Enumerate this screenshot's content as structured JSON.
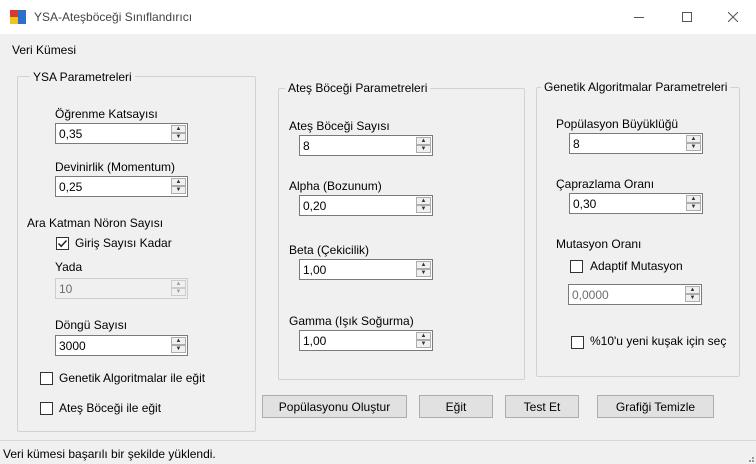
{
  "window": {
    "title": "YSA-Ateşböceği Sınıflandırıcı"
  },
  "menu": {
    "items": [
      "Veri Kümesi"
    ]
  },
  "ysa": {
    "title": "YSA Parametreleri",
    "learning_rate_label": "Öğrenme Katsayısı",
    "learning_rate": "0,35",
    "momentum_label": "Devinirlik (Momentum)",
    "momentum": "0,25",
    "hidden_label": "Ara Katman Nöron Sayısı",
    "input_count_label": "Giriş Sayısı Kadar",
    "input_count_checked": true,
    "or_label": "Yada",
    "hidden_count": "10",
    "epochs_label": "Döngü Sayısı",
    "epochs": "3000",
    "train_ga_label": "Genetik Algoritmalar ile eğit",
    "train_ga_checked": false,
    "train_fa_label": "Ateş Böceği ile eğit",
    "train_fa_checked": false
  },
  "firefly": {
    "title": "Ateş Böceği Parametreleri",
    "count_label": "Ateş Böceği Sayısı",
    "count": "8",
    "alpha_label": "Alpha (Bozunum)",
    "alpha": "0,20",
    "beta_label": "Beta (Çekicilik)",
    "beta": "1,00",
    "gamma_label": "Gamma (Işık Soğurma)",
    "gamma": "1,00"
  },
  "genetic": {
    "title": "Genetik Algoritmalar Parametreleri",
    "pop_label": "Popülasyon Büyüklüğü",
    "pop": "8",
    "crossover_label": "Çaprazlama Oranı",
    "crossover": "0,30",
    "mutation_label": "Mutasyon Oranı",
    "adaptive_label": "Adaptif Mutasyon",
    "adaptive_checked": false,
    "mutation": "0,0000",
    "elite_label": "%10'u yeni kuşak için seç",
    "elite_checked": false
  },
  "buttons": {
    "create_population": "Popülasyonu Oluştur",
    "train": "Eğit",
    "test": "Test Et",
    "clear_chart": "Grafiği Temizle"
  },
  "status": {
    "text": "Veri kümesi başarılı bir şekilde yüklendi."
  },
  "icons": {
    "minimize": "minimize-icon",
    "maximize": "maximize-icon",
    "close": "close-icon",
    "check": "checkmark-icon"
  },
  "colors": {
    "app_icon_red": "#d9392e",
    "app_icon_blue": "#2f6fc9",
    "app_icon_yellow": "#f2c318"
  }
}
